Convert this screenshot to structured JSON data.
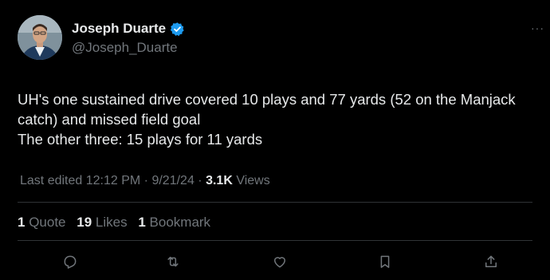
{
  "author": {
    "name": "Joseph Duarte",
    "handle": "@Joseph_Duarte",
    "verified": true,
    "verified_color": "#1d9bf0"
  },
  "tweet": {
    "lines": [
      "UH's one sustained drive covered 10 plays and 77 yards (52 on the Manjack",
      "catch) and missed field goal",
      "The other three: 15 plays for 11 yards"
    ]
  },
  "meta": {
    "edited_label": "Last edited",
    "time": "12:12 PM",
    "date": "9/21/24",
    "views_count": "3.1K",
    "views_label": "Views"
  },
  "stats": {
    "quotes": {
      "count": "1",
      "label": "Quote"
    },
    "likes": {
      "count": "19",
      "label": "Likes"
    },
    "bookmarks": {
      "count": "1",
      "label": "Bookmark"
    }
  },
  "icons": {
    "more": "more-icon",
    "reply": "reply-icon",
    "retweet": "retweet-icon",
    "like": "heart-icon",
    "bookmark": "bookmark-icon",
    "share": "share-icon"
  },
  "colors": {
    "background": "#000000",
    "text": "#e7e9ea",
    "secondary": "#71767b",
    "divider": "#2f3336"
  }
}
